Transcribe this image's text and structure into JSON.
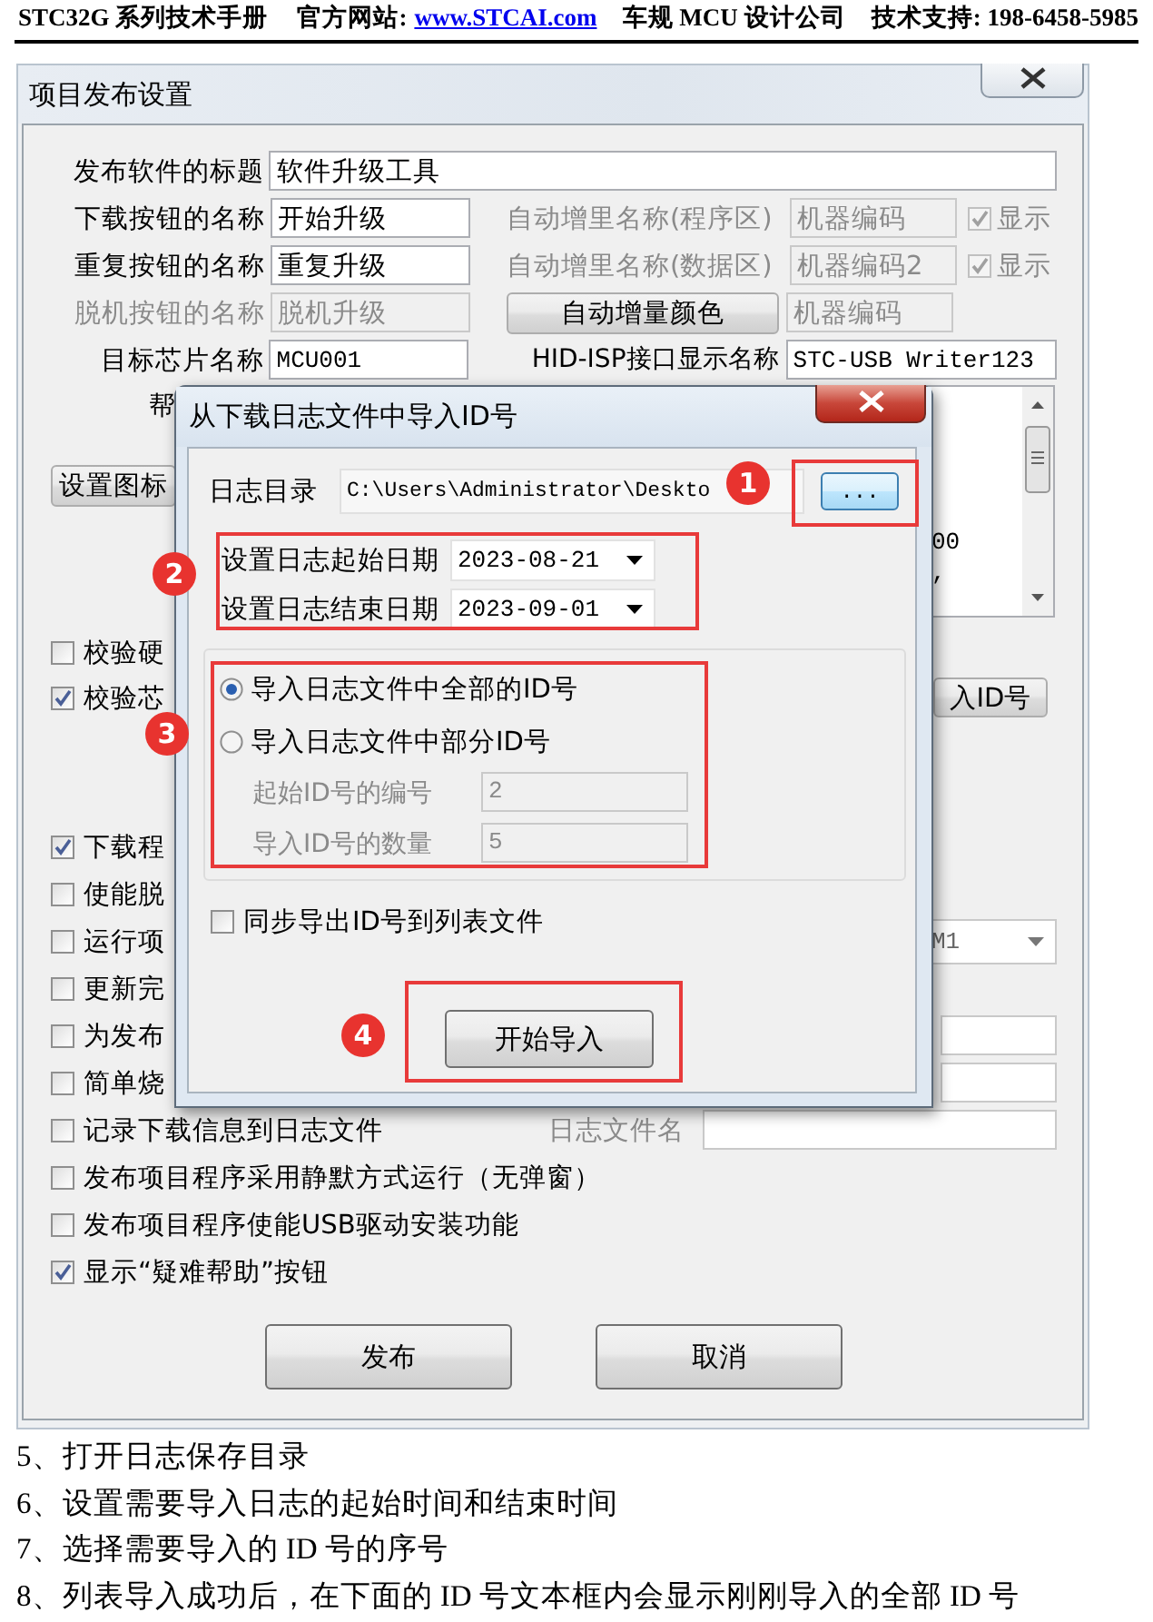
{
  "header": {
    "series": "STC32G 系列技术手册",
    "site_label": "官方网站:",
    "site_link": "www.STCAI.com",
    "company": "车规 MCU 设计公司",
    "support": "技术支持: 198-6458-5985"
  },
  "window": {
    "title": "项目发布设置",
    "software_title": {
      "label": "发布软件的标题",
      "value": "软件升级工具"
    },
    "name_rows": [
      {
        "label": "下载按钮的名称",
        "value": "开始升级",
        "auto_label": "自动增里名称(程序区)",
        "auto_value": "机器编码",
        "auto_disabled": true,
        "show_label": "显示",
        "show_checked": true
      },
      {
        "label": "重复按钮的名称",
        "value": "重复升级",
        "auto_label": "自动增里名称(数据区)",
        "auto_value": "机器编码2",
        "auto_disabled": true,
        "show_label": "显示",
        "show_checked": true
      }
    ],
    "offline_row": {
      "label": "脱机按钮的名称",
      "value": "脱机升级",
      "disabled": true,
      "color_button": "自动增量颜色",
      "sample": "机器编码"
    },
    "chip_row": {
      "label": "目标芯片名称",
      "value": "MCU001",
      "hid_label": "HID-ISP接口显示名称",
      "hid_value": "STC-USB Writer123"
    },
    "help_label": "帮",
    "help_text": [
      "00",
      ","
    ],
    "icon_button": "设置图标",
    "upper_checks": [
      {
        "label": "校验硬",
        "checked": false
      },
      {
        "label": "校验芯",
        "checked": true,
        "side": {
          "kind": "button",
          "label": "入ID号"
        }
      }
    ],
    "lower_checks": [
      {
        "label": "下载程",
        "checked": true
      },
      {
        "label": "使能脱",
        "checked": false
      },
      {
        "label": "运行项",
        "checked": false,
        "side": {
          "kind": "dropdown",
          "value": "M1"
        }
      },
      {
        "label": "更新完",
        "checked": false
      },
      {
        "label": "为发布",
        "checked": false,
        "side": {
          "kind": "field"
        }
      },
      {
        "label": "简单烧",
        "checked": false,
        "side": {
          "kind": "field"
        }
      },
      {
        "label": "记录下载信息到日志文件",
        "checked": false,
        "side": {
          "kind": "labeled_field",
          "label": "日志文件名"
        }
      },
      {
        "label": "发布项目程序采用静默方式运行（无弹窗）",
        "checked": false
      },
      {
        "label": "发布项目程序使能USB驱动安装功能",
        "checked": false
      },
      {
        "label": "显示“疑难帮助”按钮",
        "checked": true
      }
    ],
    "buttons": [
      "发布",
      "取消"
    ]
  },
  "dialog": {
    "title": "从下载日志文件中导入ID号",
    "dir_label": "日志目录",
    "dir_value": "C:\\Users\\Administrator\\Deskto",
    "browse": "...",
    "dates": [
      {
        "label": "设置日志起始日期",
        "value": "2023-08-21"
      },
      {
        "label": "设置日志结束日期",
        "value": "2023-09-01"
      }
    ],
    "modes": [
      {
        "label": "导入日志文件中全部的ID号",
        "selected": true
      },
      {
        "label": "导入日志文件中部分ID号",
        "selected": false
      }
    ],
    "range_disabled": true,
    "range": [
      {
        "label": "起始ID号的编号",
        "value": "2"
      },
      {
        "label": "导入ID号的数量",
        "value": "5"
      }
    ],
    "sync": {
      "label": "同步导出ID号到列表文件",
      "checked": false
    },
    "start_button": "开始导入"
  },
  "callouts": [
    "1",
    "2",
    "3",
    "4"
  ],
  "notes": [
    "5、打开日志保存目录",
    "6、设置需要导入日志的起始时间和结束时间",
    "7、选择需要导入的 ID 号的序号",
    "8、列表导入成功后，在下面的 ID 号文本框内会显示刚刚导入的全部 ID 号"
  ]
}
